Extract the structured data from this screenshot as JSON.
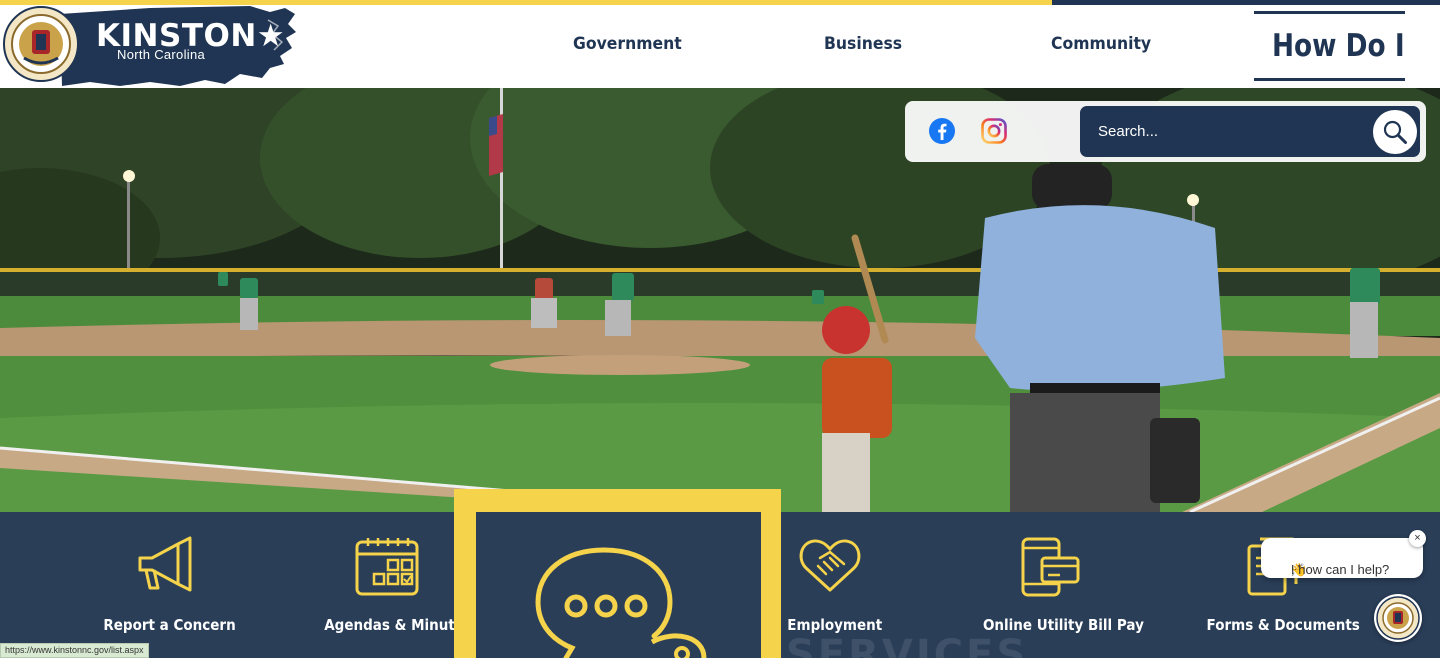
{
  "header": {
    "logo": {
      "name": "KINSTON",
      "star": "★",
      "subtitle": "North Carolina",
      "seal_icon": "city-seal-icon"
    },
    "nav": {
      "government": "Government",
      "business": "Business",
      "community": "Community",
      "how_do_i": "How Do I"
    }
  },
  "social": {
    "facebook_icon": "facebook-icon",
    "instagram_icon": "instagram-icon"
  },
  "search": {
    "placeholder": "Search...",
    "button_icon": "magnifier-icon"
  },
  "quick_links": [
    {
      "label": "Report a Concern",
      "icon": "megaphone-icon"
    },
    {
      "label": "Agendas & Minutes",
      "icon": "calendar-icon"
    },
    {
      "label": "",
      "icon": "chat-bubbles-icon",
      "featured": true
    },
    {
      "label": "Employment",
      "icon": "handshake-icon"
    },
    {
      "label": "Online Utility Bill Pay",
      "icon": "phone-card-icon"
    },
    {
      "label": "Forms & Documents",
      "icon": "documents-icon"
    }
  ],
  "ghost_heading": "SERVICES",
  "chat": {
    "greeting_prefix": "Hi",
    "greeting_emoji": "👋",
    "greeting_suffix": ", how can I help?",
    "close": "×"
  },
  "status_bar": {
    "url": "https://www.kinstonnc.gov/list.aspx"
  },
  "colors": {
    "navy": "#1f3553",
    "bar": "#2a3e58",
    "accent_yellow": "#f5d34a",
    "white": "#ffffff"
  }
}
